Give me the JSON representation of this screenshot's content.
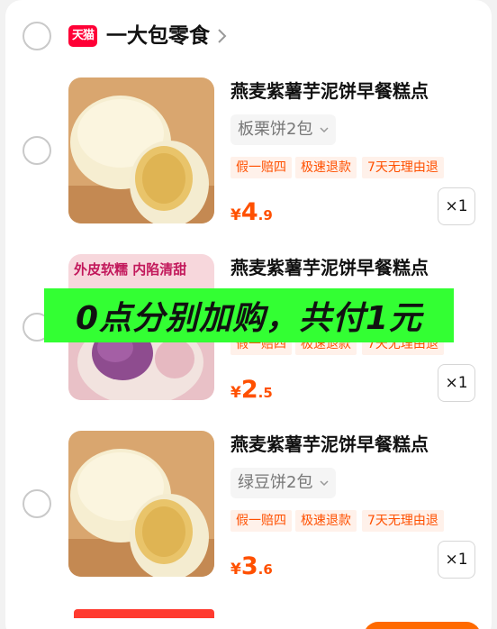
{
  "shop": {
    "badge": "天猫",
    "name": "一大包零食"
  },
  "items": [
    {
      "title": "燕麦紫薯芋泥饼早餐糕点",
      "sku": "板栗饼2包",
      "tags": [
        "假一赔四",
        "极速退款",
        "7天无理由退"
      ],
      "price_currency": "¥",
      "price_int": "4",
      "price_dec": ".9",
      "qty": "×1"
    },
    {
      "title": "燕麦紫薯芋泥饼早餐糕点",
      "image_text": "外皮软糯 内陷清甜",
      "tags": [
        "假一赔四",
        "极速退款",
        "7天无理由退"
      ],
      "price_currency": "¥",
      "price_int": "2",
      "price_dec": ".5",
      "qty": "×1"
    },
    {
      "title": "燕麦紫薯芋泥饼早餐糕点",
      "sku": "绿豆饼2包",
      "tags": [
        "假一赔四",
        "极速退款",
        "7天无理由退"
      ],
      "price_currency": "¥",
      "price_int": "3",
      "price_dec": ".6",
      "qty": "×1"
    }
  ],
  "overlay": {
    "text": "0点分别加购，共付1元"
  },
  "colors": {
    "accent": "#ff5000",
    "tmall": "#ff0036",
    "overlay_bg": "#33ff33"
  }
}
